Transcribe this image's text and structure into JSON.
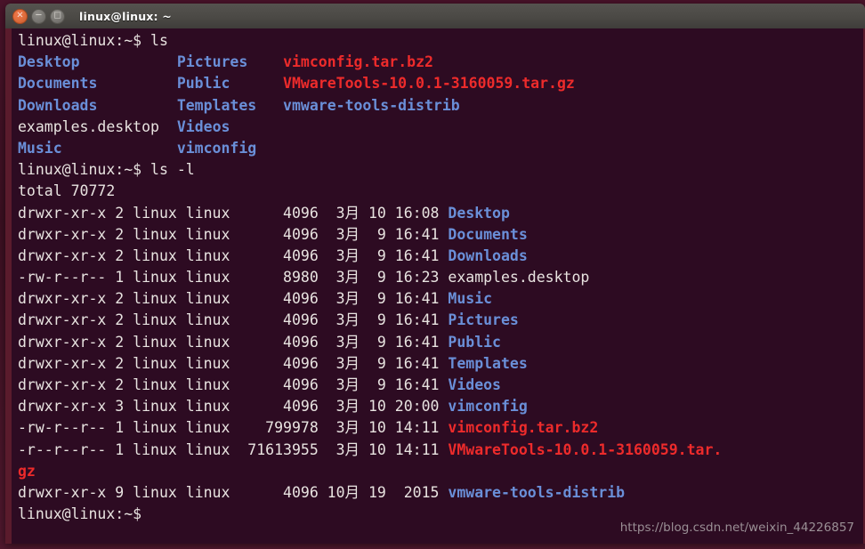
{
  "window": {
    "title": "linux@linux: ~",
    "controls": [
      {
        "name": "close",
        "glyph": "×"
      },
      {
        "name": "minimize",
        "glyph": "−"
      },
      {
        "name": "maximize",
        "glyph": "□"
      }
    ]
  },
  "colors": {
    "terminal_bg": "#2d0b22",
    "titlebar_bg": "#4b4945",
    "desktop_bg": "#3d1022",
    "window_border": "#5a1b2c",
    "text": "#e8e3e0",
    "directory": "#6a8fd8",
    "archive": "#ed2b2b",
    "close_button": "#e2703f",
    "watermark": "#9a8f95"
  },
  "prompt": "linux@linux:~$ ",
  "commands": {
    "ls": "ls",
    "ls_l": "ls -l"
  },
  "ls_output": {
    "rows": [
      [
        {
          "text": "Desktop",
          "type": "dir"
        },
        {
          "text": "Pictures",
          "type": "dir"
        },
        {
          "text": "vimconfig.tar.bz2",
          "type": "arc"
        }
      ],
      [
        {
          "text": "Documents",
          "type": "dir"
        },
        {
          "text": "Public",
          "type": "dir"
        },
        {
          "text": "VMwareTools-10.0.1-3160059.tar.gz",
          "type": "arc"
        }
      ],
      [
        {
          "text": "Downloads",
          "type": "dir"
        },
        {
          "text": "Templates",
          "type": "dir"
        },
        {
          "text": "vmware-tools-distrib",
          "type": "dir"
        }
      ],
      [
        {
          "text": "examples.desktop",
          "type": "plain"
        },
        {
          "text": "Videos",
          "type": "dir"
        },
        {
          "text": "",
          "type": "plain"
        }
      ],
      [
        {
          "text": "Music",
          "type": "dir"
        },
        {
          "text": "vimconfig",
          "type": "dir"
        },
        {
          "text": "",
          "type": "plain"
        }
      ]
    ],
    "column_starts": [
      0,
      18,
      30
    ]
  },
  "ls_l_output": {
    "total_label": "total 70772",
    "entries": [
      {
        "perms": "drwxr-xr-x",
        "links": "2",
        "owner": "linux",
        "group": "linux",
        "size": "4096",
        "month": "3月",
        "day": "10",
        "time": "16:08",
        "name": "Desktop",
        "type": "dir"
      },
      {
        "perms": "drwxr-xr-x",
        "links": "2",
        "owner": "linux",
        "group": "linux",
        "size": "4096",
        "month": "3月",
        "day": "9",
        "time": "16:41",
        "name": "Documents",
        "type": "dir"
      },
      {
        "perms": "drwxr-xr-x",
        "links": "2",
        "owner": "linux",
        "group": "linux",
        "size": "4096",
        "month": "3月",
        "day": "9",
        "time": "16:41",
        "name": "Downloads",
        "type": "dir"
      },
      {
        "perms": "-rw-r--r--",
        "links": "1",
        "owner": "linux",
        "group": "linux",
        "size": "8980",
        "month": "3月",
        "day": "9",
        "time": "16:23",
        "name": "examples.desktop",
        "type": "plain"
      },
      {
        "perms": "drwxr-xr-x",
        "links": "2",
        "owner": "linux",
        "group": "linux",
        "size": "4096",
        "month": "3月",
        "day": "9",
        "time": "16:41",
        "name": "Music",
        "type": "dir"
      },
      {
        "perms": "drwxr-xr-x",
        "links": "2",
        "owner": "linux",
        "group": "linux",
        "size": "4096",
        "month": "3月",
        "day": "9",
        "time": "16:41",
        "name": "Pictures",
        "type": "dir"
      },
      {
        "perms": "drwxr-xr-x",
        "links": "2",
        "owner": "linux",
        "group": "linux",
        "size": "4096",
        "month": "3月",
        "day": "9",
        "time": "16:41",
        "name": "Public",
        "type": "dir"
      },
      {
        "perms": "drwxr-xr-x",
        "links": "2",
        "owner": "linux",
        "group": "linux",
        "size": "4096",
        "month": "3月",
        "day": "9",
        "time": "16:41",
        "name": "Templates",
        "type": "dir"
      },
      {
        "perms": "drwxr-xr-x",
        "links": "2",
        "owner": "linux",
        "group": "linux",
        "size": "4096",
        "month": "3月",
        "day": "9",
        "time": "16:41",
        "name": "Videos",
        "type": "dir"
      },
      {
        "perms": "drwxr-xr-x",
        "links": "3",
        "owner": "linux",
        "group": "linux",
        "size": "4096",
        "month": "3月",
        "day": "10",
        "time": "20:00",
        "name": "vimconfig",
        "type": "dir"
      },
      {
        "perms": "-rw-r--r--",
        "links": "1",
        "owner": "linux",
        "group": "linux",
        "size": "799978",
        "month": "3月",
        "day": "10",
        "time": "14:11",
        "name": "vimconfig.tar.bz2",
        "type": "arc"
      },
      {
        "perms": "-r--r--r--",
        "links": "1",
        "owner": "linux",
        "group": "linux",
        "size": "71613955",
        "month": "3月",
        "day": "10",
        "time": "14:11",
        "name": "VMwareTools-10.0.1-3160059.tar.gz",
        "type": "arc"
      },
      {
        "perms": "drwxr-xr-x",
        "links": "9",
        "owner": "linux",
        "group": "linux",
        "size": "4096",
        "month": "10月",
        "day": "19",
        "time": "2015",
        "name": "vmware-tools-distrib",
        "type": "dir"
      }
    ]
  },
  "watermark": "https://blog.csdn.net/weixin_44226857"
}
